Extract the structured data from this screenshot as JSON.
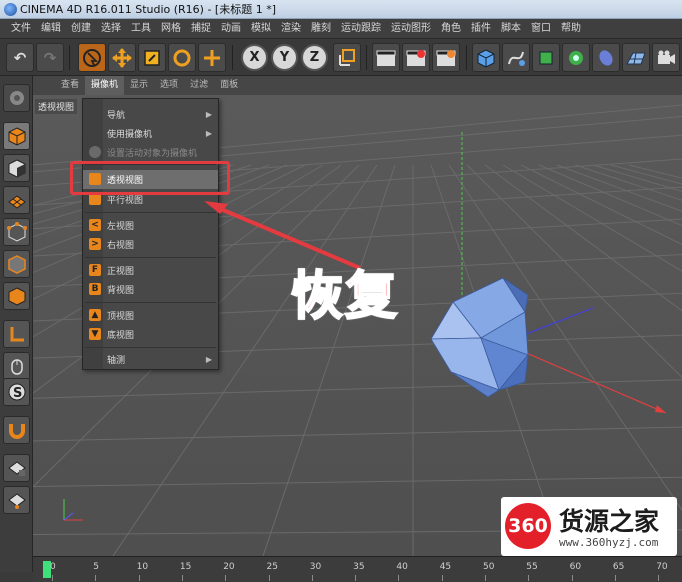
{
  "window": {
    "title": "CINEMA 4D R16.011 Studio (R16) - [未标题 1 *]"
  },
  "menubar": [
    "文件",
    "编辑",
    "创建",
    "选择",
    "工具",
    "网格",
    "捕捉",
    "动画",
    "模拟",
    "渲染",
    "雕刻",
    "运动跟踪",
    "运动图形",
    "角色",
    "插件",
    "脚本",
    "窗口",
    "帮助"
  ],
  "toolbar": {
    "axis_x": "X",
    "axis_y": "Y",
    "axis_z": "Z"
  },
  "viewport": {
    "menu": [
      "查看",
      "摄像机",
      "显示",
      "选项",
      "过滤",
      "面板"
    ],
    "active_menu_index": 1,
    "label": "透视视图"
  },
  "dropdown": {
    "nav": "导航",
    "use_camera": "使用摄像机",
    "set_active": "设置活动对象为摄像机",
    "perspective": "透视视图",
    "parallel": "平行视图",
    "left": "左视图",
    "right": "右视图",
    "front": "正视图",
    "back": "背视图",
    "top": "顶视图",
    "bottom": "底视图",
    "axonometric": "轴测",
    "icon_left": "<",
    "icon_right": ">",
    "icon_front": "F",
    "icon_back": "B"
  },
  "annotation": {
    "text": "恢复"
  },
  "timeline": {
    "ticks": [
      "0",
      "5",
      "10",
      "15",
      "20",
      "25",
      "30",
      "35",
      "40",
      "45",
      "50",
      "55",
      "60",
      "65",
      "70"
    ]
  },
  "watermark": {
    "badge": "360",
    "title": "货源之家",
    "url": "www.360hyzj.com"
  },
  "colors": {
    "accent": "#e8861c",
    "highlight": "#e33b3f",
    "annotation": "#ff5660",
    "object": "#6d9be8"
  }
}
